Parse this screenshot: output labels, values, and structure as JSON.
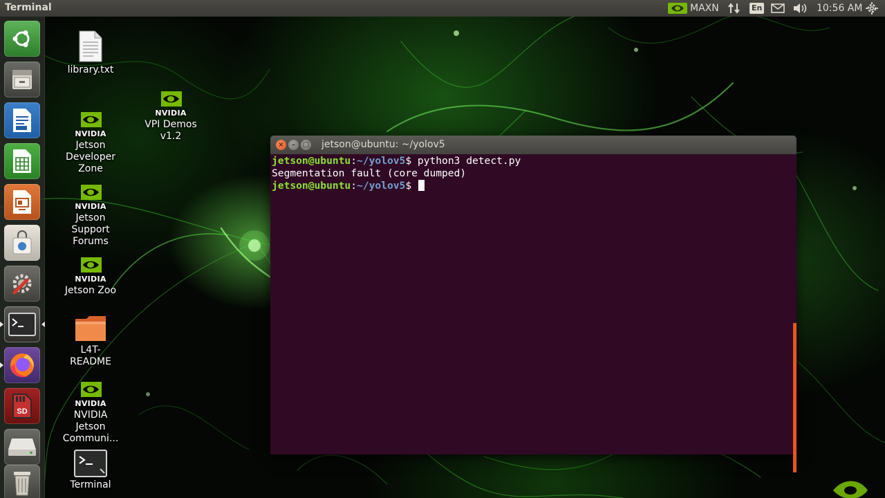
{
  "top_panel": {
    "app_title": "Terminal",
    "power_mode": "MAXN",
    "keyboard_layout": "En",
    "clock": "10:56 AM",
    "icons": [
      "nvidia-icon",
      "network-icon",
      "keyboard-layout-indicator",
      "mail-icon",
      "volume-icon",
      "settings-gear-icon"
    ]
  },
  "launcher": {
    "items": [
      {
        "name": "ubuntu-dash",
        "icon": "ubuntu-logo-icon"
      },
      {
        "name": "files",
        "icon": "file-cabinet-icon"
      },
      {
        "name": "libreoffice-writer",
        "icon": "document-icon"
      },
      {
        "name": "libreoffice-calc",
        "icon": "spreadsheet-icon"
      },
      {
        "name": "libreoffice-impress",
        "icon": "presentation-icon"
      },
      {
        "name": "software-center",
        "icon": "shopping-bag-icon"
      },
      {
        "name": "system-settings",
        "icon": "wrench-gear-icon"
      },
      {
        "name": "terminal",
        "icon": "terminal-icon",
        "active": true
      },
      {
        "name": "firefox",
        "icon": "firefox-icon",
        "running": true
      },
      {
        "name": "sd-card",
        "icon": "sd-card-icon",
        "label": "SD"
      },
      {
        "name": "drive",
        "icon": "drive-icon"
      },
      {
        "name": "trash",
        "icon": "trash-icon"
      }
    ]
  },
  "desktop": {
    "icons": [
      {
        "id": "library-txt",
        "label": "library.txt",
        "icon": "text-file-icon"
      },
      {
        "id": "vpi-demos",
        "brand": "NVIDIA",
        "label": "VPI Demos v1.2",
        "icon": "nvidia-logo-icon"
      },
      {
        "id": "jetson-developer-zone",
        "brand": "NVIDIA",
        "label": "Jetson Developer Zone",
        "icon": "nvidia-logo-icon"
      },
      {
        "id": "jetson-support-forums",
        "brand": "NVIDIA",
        "label": "Jetson Support Forums",
        "icon": "nvidia-logo-icon"
      },
      {
        "id": "jetson-zoo",
        "brand": "NVIDIA",
        "label": "Jetson Zoo",
        "icon": "nvidia-logo-icon"
      },
      {
        "id": "l4t-readme",
        "label": "L4T-README",
        "icon": "folder-icon"
      },
      {
        "id": "nvidia-jetson-community",
        "brand": "NVIDIA",
        "label": "NVIDIA Jetson Communi...",
        "icon": "nvidia-logo-icon"
      },
      {
        "id": "terminal",
        "label": "Terminal",
        "icon": "terminal-icon"
      }
    ]
  },
  "terminal_window": {
    "title": "jetson@ubuntu: ~/yolov5",
    "prompt_user": "jetson@ubuntu",
    "prompt_sep": ":",
    "prompt_path": "~/yolov5",
    "prompt_symbol": "$ ",
    "lines": [
      {
        "type": "prompt",
        "command": "python3 detect.py"
      },
      {
        "type": "output",
        "text": "Segmentation fault (core dumped)"
      },
      {
        "type": "prompt",
        "command": ""
      }
    ]
  },
  "colors": {
    "terminal_bg": "#300a24",
    "prompt_user": "#8ae234",
    "prompt_path": "#729fcf",
    "accent_orange": "#e95420",
    "nvidia_green": "#76b900",
    "panel_bg": "#3b3a36"
  }
}
